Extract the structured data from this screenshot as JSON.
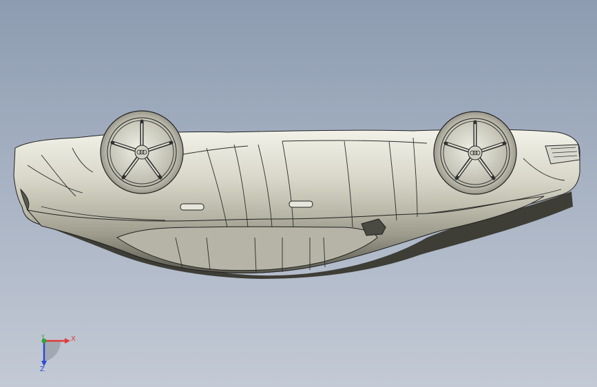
{
  "viewport": {
    "background_top": "#8d9cb1",
    "background_bottom": "#c3cad5",
    "model_color": "#c9c8b9",
    "edge_color": "#202020"
  },
  "triad": {
    "x_label": "X",
    "y_label": "Y",
    "z_label": "Z",
    "x_color": "#e03a3a",
    "y_color": "#2fa33a",
    "z_color": "#2a4bd6"
  }
}
